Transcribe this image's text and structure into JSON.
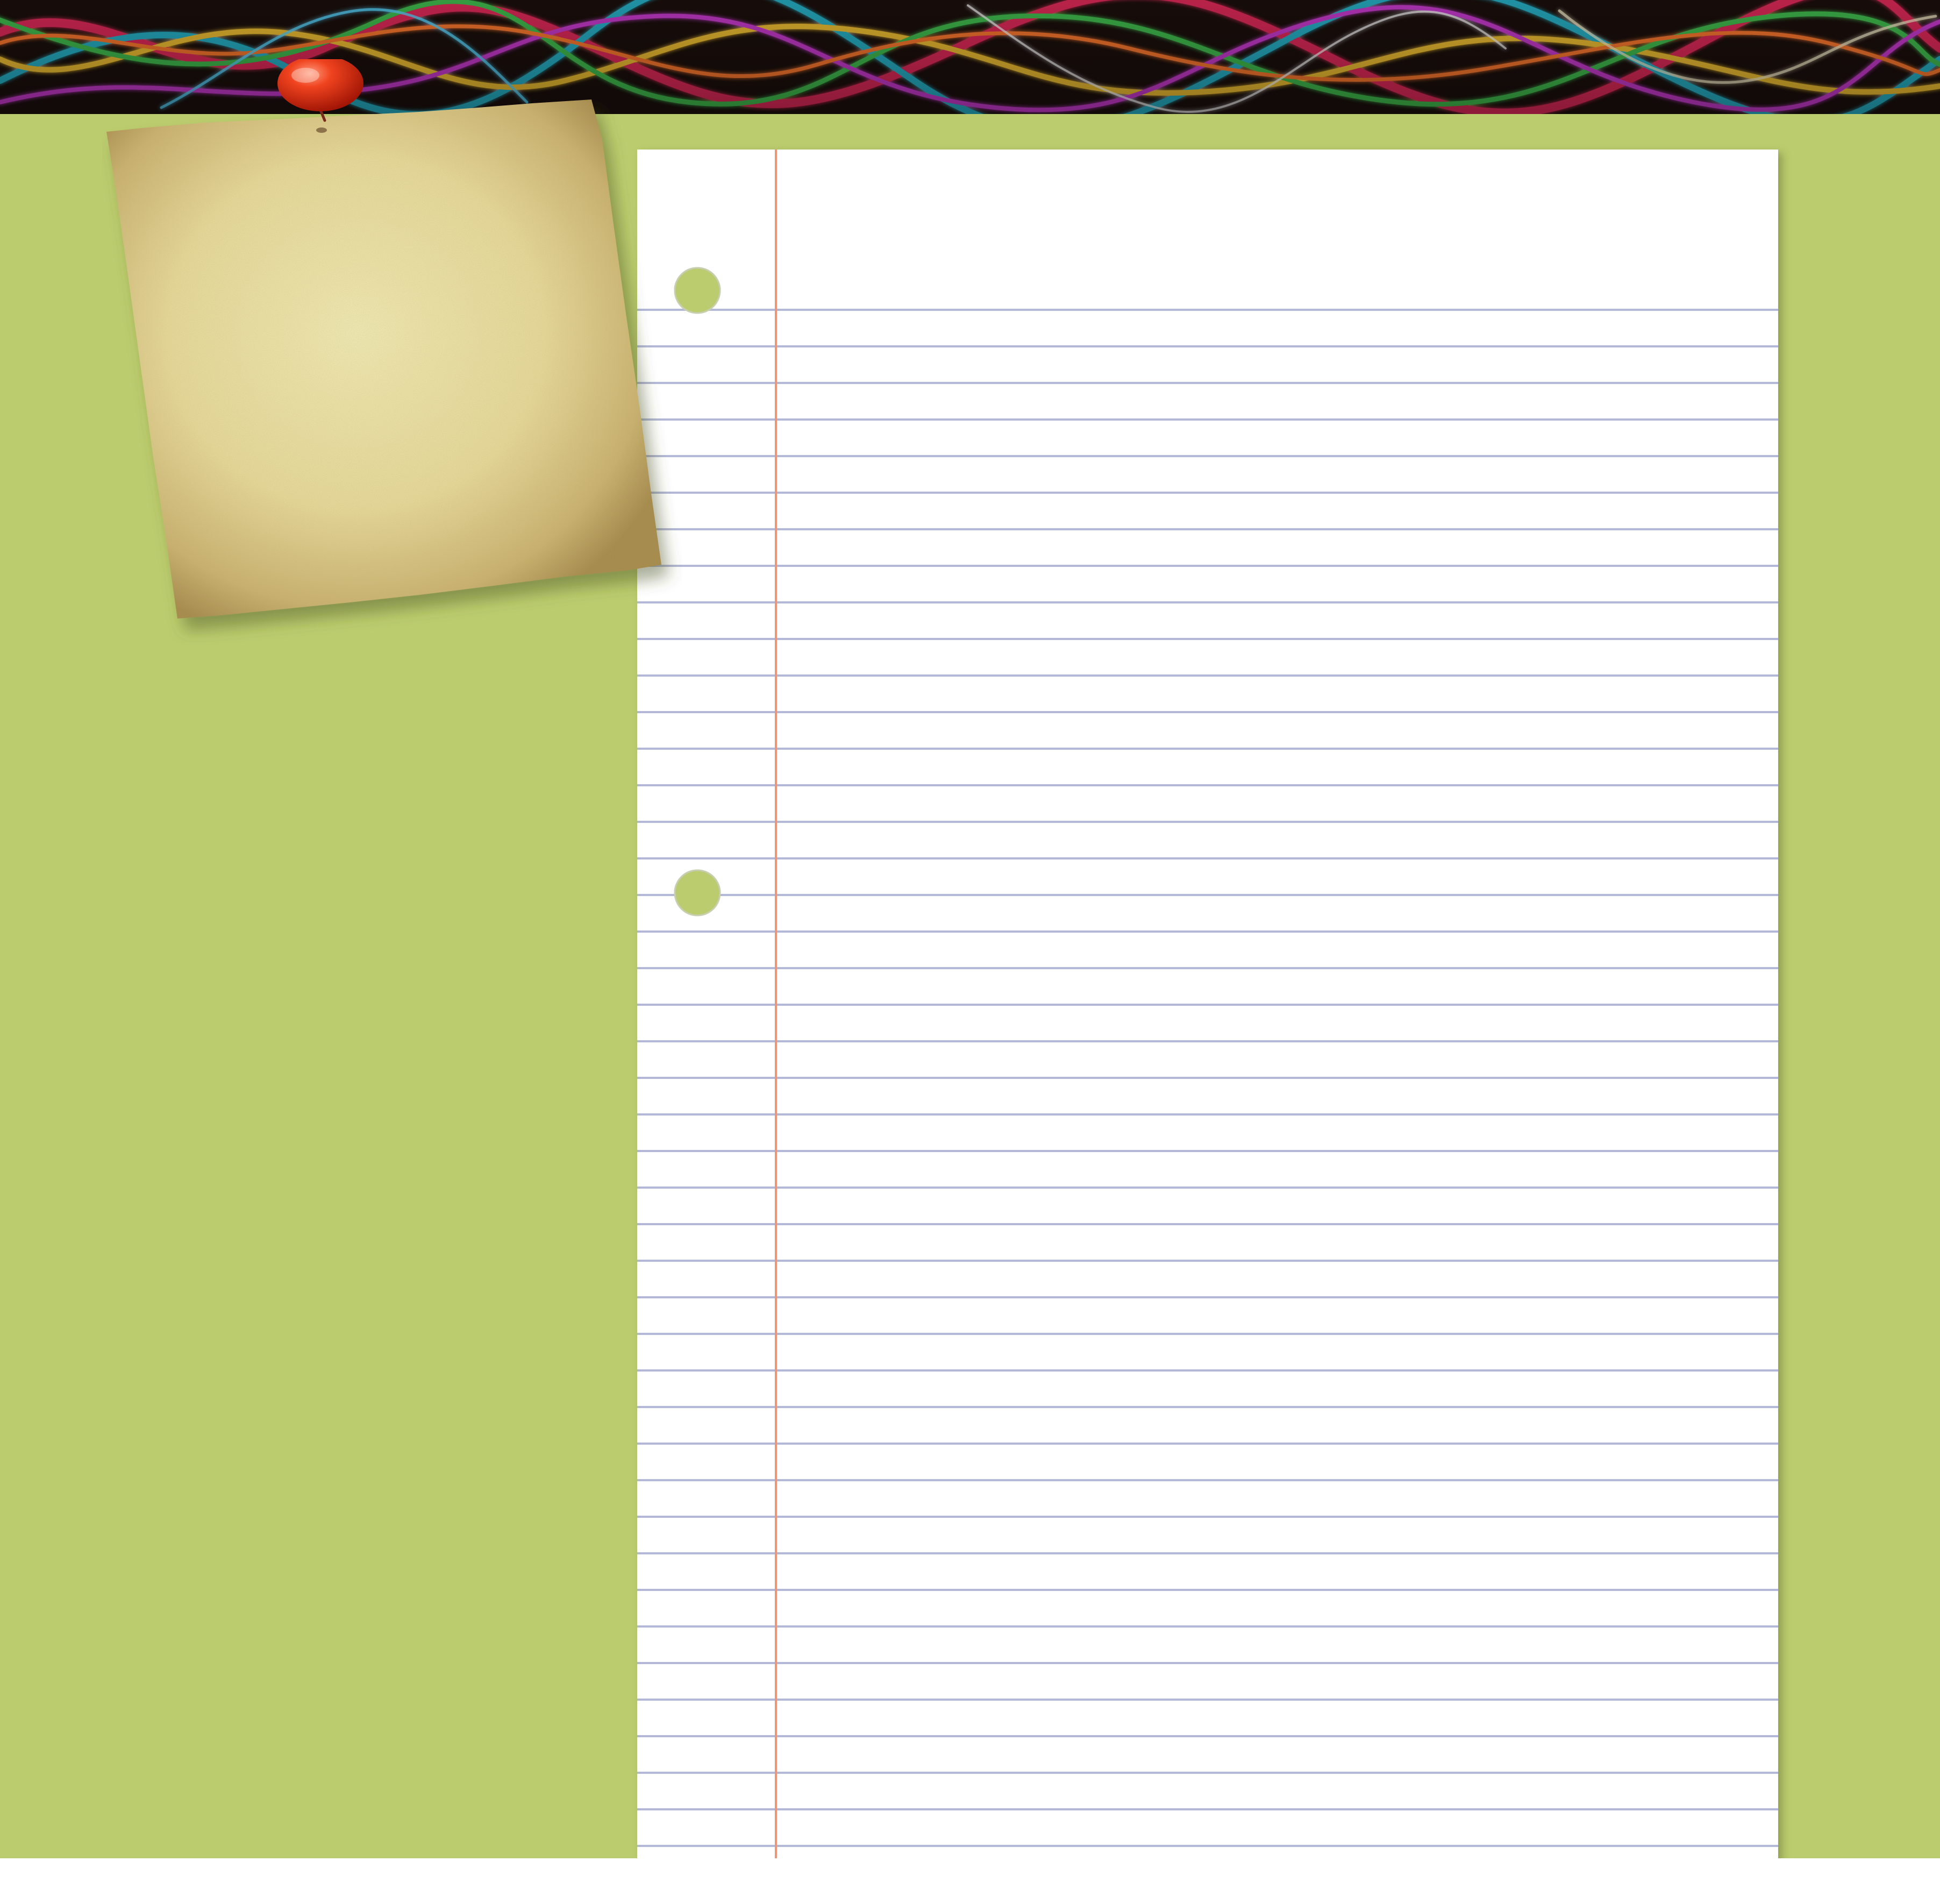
{
  "colors": {
    "background": "#bbcc6e",
    "paper": "#ffffff",
    "ruled_line": "#b3b8d6",
    "margin_line": "#e9967a",
    "note_center": "#f3ebb4",
    "note_edge": "#b39a55",
    "pin": "#e8311c",
    "banner_base": "#1a0f0c"
  },
  "icons": {
    "pin": "push-pin-icon"
  }
}
